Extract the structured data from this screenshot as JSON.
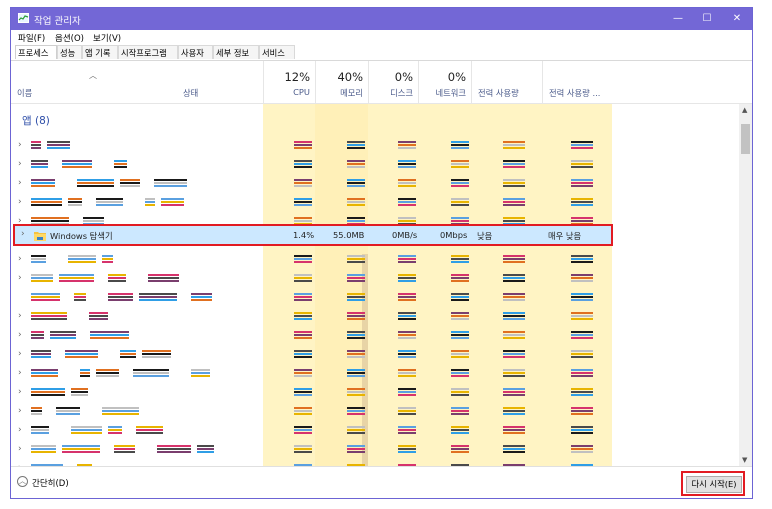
{
  "window": {
    "title": "작업 관리자"
  },
  "menu": [
    "파일(F)",
    "옵션(O)",
    "보기(V)"
  ],
  "tabs": [
    "프로세스",
    "성능",
    "앱 기록",
    "시작프로그램",
    "사용자",
    "세부 정보",
    "서비스"
  ],
  "columns": {
    "name": "이름",
    "status": "상태",
    "cpu": {
      "pct": "12%",
      "label": "CPU"
    },
    "memory": {
      "pct": "40%",
      "label": "메모리"
    },
    "disk": {
      "pct": "0%",
      "label": "디스크"
    },
    "network": {
      "pct": "0%",
      "label": "네트워크"
    },
    "power": "전력 사용량",
    "power_trend": "전력 사용량 ..."
  },
  "group": {
    "label": "앱 (8)"
  },
  "selected_row": {
    "name": "Windows 탐색기",
    "cpu": "1.4%",
    "memory": "55.0MB",
    "disk": "0MB/s",
    "network": "0Mbps",
    "power": "낮음",
    "power_trend": "매우 낮음"
  },
  "footer": {
    "fewer_details": "간단히(D)",
    "restart": "다시 시작(E)"
  },
  "colors": {
    "titlebar": "#7367d6",
    "selection": "#cce8ff",
    "highlight": "#e21b22",
    "heat": "#fff4c4"
  }
}
